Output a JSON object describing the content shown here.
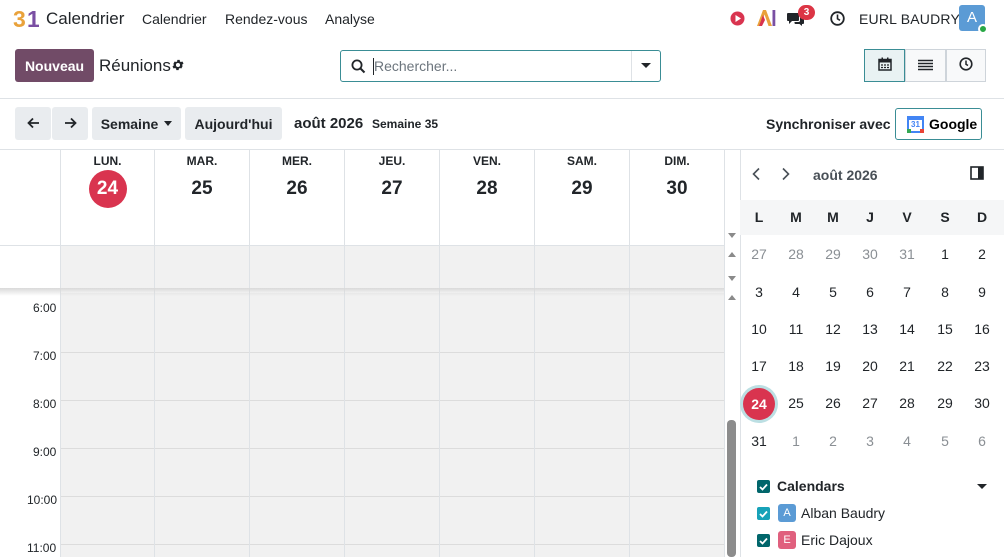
{
  "navbar": {
    "logo_text": "31",
    "app_name": "Calendrier",
    "menus": [
      "Calendrier",
      "Rendez-vous",
      "Analyse"
    ],
    "messages_count": "3",
    "company": "EURL BAUDRY",
    "user_initial": "A"
  },
  "control": {
    "new_label": "Nouveau",
    "title": "Réunions",
    "search_placeholder": "Rechercher..."
  },
  "toolbar": {
    "scale_label": "Semaine",
    "today_label": "Aujourd'hui",
    "period": "août 2026",
    "week": "Semaine 35",
    "sync_label": "Synchroniser avec",
    "google_label": "Google",
    "google_icon_text": "31"
  },
  "week": {
    "days": [
      {
        "dow": "LUN.",
        "num": "24"
      },
      {
        "dow": "MAR.",
        "num": "25"
      },
      {
        "dow": "MER.",
        "num": "26"
      },
      {
        "dow": "JEU.",
        "num": "27"
      },
      {
        "dow": "VEN.",
        "num": "28"
      },
      {
        "dow": "SAM.",
        "num": "29"
      },
      {
        "dow": "DIM.",
        "num": "30"
      }
    ],
    "hours": [
      "6:00",
      "7:00",
      "8:00",
      "9:00",
      "10:00",
      "11:00"
    ]
  },
  "mini": {
    "title": "août 2026",
    "weekdays": [
      "L",
      "M",
      "M",
      "J",
      "V",
      "S",
      "D"
    ],
    "rows": [
      [
        "27",
        "28",
        "29",
        "30",
        "31",
        "1",
        "2"
      ],
      [
        "3",
        "4",
        "5",
        "6",
        "7",
        "8",
        "9"
      ],
      [
        "10",
        "11",
        "12",
        "13",
        "14",
        "15",
        "16"
      ],
      [
        "17",
        "18",
        "19",
        "20",
        "21",
        "22",
        "23"
      ],
      [
        "24",
        "25",
        "26",
        "27",
        "28",
        "29",
        "30"
      ],
      [
        "31",
        "1",
        "2",
        "3",
        "4",
        "5",
        "6"
      ]
    ]
  },
  "filters": {
    "section": "Calendars",
    "users": [
      {
        "initial": "A",
        "name": "Alban Baudry",
        "color": "#5b9bd5",
        "check": "#17a2b8"
      },
      {
        "initial": "E",
        "name": "Eric Dajoux",
        "color": "#e0607e",
        "check": "#01666b"
      }
    ]
  },
  "colors": {
    "brand": "#714b67",
    "accent": "#017e84",
    "today": "#d9344f"
  }
}
